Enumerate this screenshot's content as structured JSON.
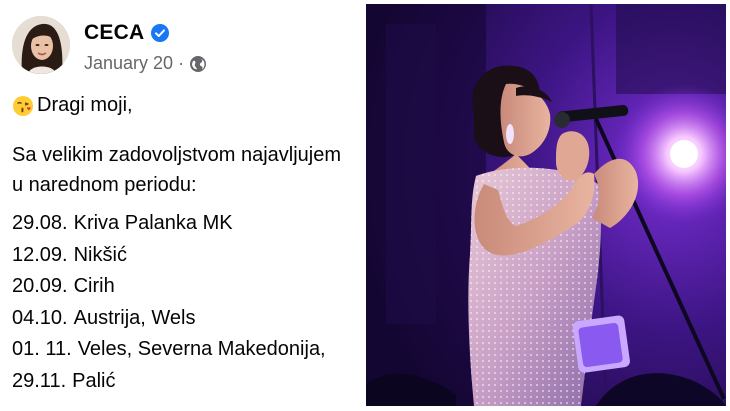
{
  "post": {
    "author": "CECA",
    "verified_icon": "verified-badge-icon",
    "date": "January 20",
    "separator": "·",
    "audience_icon": "globe-icon",
    "greeting_emoji": "face-blowing-kiss-emoji",
    "greeting": "Dragi moji,",
    "intro_line1": "Sa velikim zadovoljstvom najavljujem",
    "intro_line2": "u narednom periodu:",
    "dates": [
      {
        "date": "29.08.",
        "place": "Kriva Palanka MK"
      },
      {
        "date": "12.09.",
        "place": "Nikšić"
      },
      {
        "date": "20.09.",
        "place": "Cirih"
      },
      {
        "date": "04.10.",
        "place": "Austrija, Wels"
      },
      {
        "date": "01. 11.",
        "place": "Veles, Severna Makedonija,"
      },
      {
        "date": "29.11.",
        "place": "Palić"
      }
    ]
  },
  "photo": {
    "subject": "singer-performing-on-stage",
    "stage_light_color": "#f3b2ff",
    "background_color": "#2a0d59"
  },
  "colors": {
    "text": "#050505",
    "meta": "#65676b",
    "verified": "#1877f2"
  }
}
